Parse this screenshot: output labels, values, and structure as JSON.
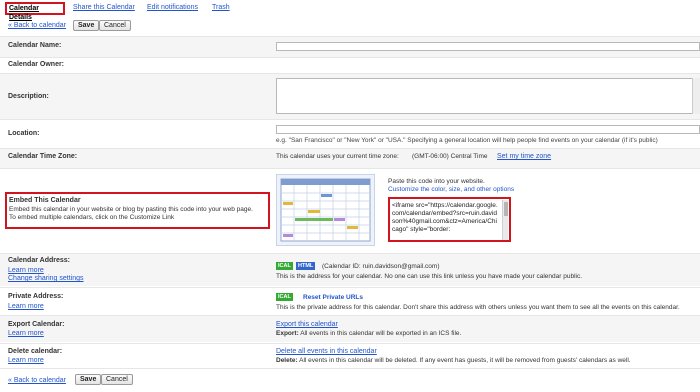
{
  "tabs": {
    "calendar_details": "Calendar Details",
    "share": "Share this Calendar",
    "edit_notifications": "Edit notifications",
    "trash": "Trash"
  },
  "top_toolbar": {
    "back": "« Back to calendar",
    "save": "Save",
    "cancel": "Cancel"
  },
  "bottom_toolbar": {
    "back": "« Back to calendar",
    "save": "Save",
    "cancel": "Cancel"
  },
  "fields": {
    "name_label": "Calendar Name:",
    "owner_label": "Calendar Owner:",
    "description_label": "Description:",
    "location_label": "Location:",
    "location_hint": "e.g. \"San Francisco\" or \"New York\" or \"USA.\" Specifying a general location will help people find events on your calendar (if it's public)",
    "timezone_label": "Calendar Time Zone:",
    "timezone_text": "This calendar uses your current time zone:",
    "timezone_value": "(GMT-06:00) Central Time",
    "timezone_link": "Set my time zone"
  },
  "embed": {
    "title": "Embed This Calendar",
    "desc_line1": "Embed this calendar in your website or blog by pasting this code into your web page.",
    "desc_line2": "To embed multiple calendars, click on the Customize Link",
    "paste_text": "Paste this code into your website.",
    "customize_link": "Customize the color, size, and other options",
    "code": "<iframe src=\"https://calendar.google.com/calendar/embed?src=ruin.davidson%40gmail.com&ctz=America/Chicago\" style=\"border:"
  },
  "address": {
    "label": "Calendar Address:",
    "learn_more": "Learn more",
    "change_sharing": "Change sharing settings",
    "ical_badge": "ICAL",
    "html_badge": "HTML",
    "calendar_id": "(Calendar ID: ruin.davidson@gmail.com)",
    "desc": "This is the address for your calendar. No one can use this link unless you have made your calendar public."
  },
  "private": {
    "label": "Private Address:",
    "learn_more": "Learn more",
    "ical_badge": "ICAL",
    "reset": "Reset Private URLs",
    "desc": "This is the private address for this calendar. Don't share this address with others unless you want them to see all the events on this calendar."
  },
  "export": {
    "label": "Export Calendar:",
    "learn_more": "Learn more",
    "link": "Export this calendar",
    "desc_bold": "Export:",
    "desc": "All events in this calendar will be exported in an ICS file."
  },
  "delete": {
    "label": "Delete calendar:",
    "learn_more": "Learn more",
    "link": "Delete all events in this calendar",
    "desc_bold": "Delete:",
    "desc": "All events in this calendar will be deleted. If any event has guests, it will be removed from guests' calendars as well."
  },
  "colors": {
    "highlight": "#d2141e",
    "link": "#2255cc",
    "ical": "#33aa33",
    "html": "#3366cc"
  }
}
